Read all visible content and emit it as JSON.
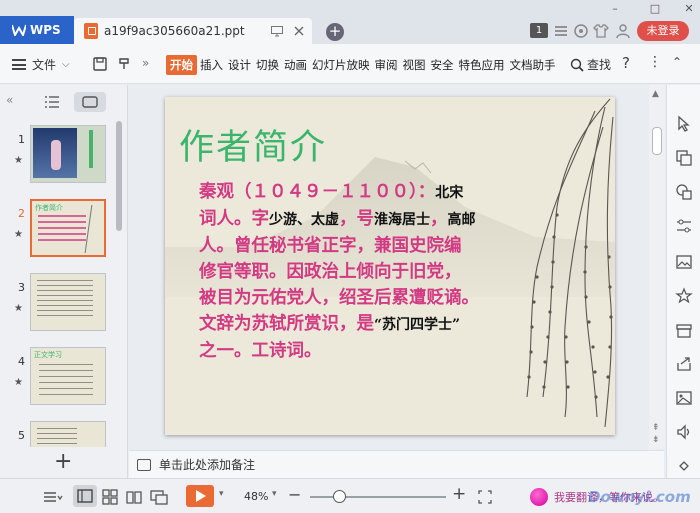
{
  "titlebar": {
    "app_tab": "WPS",
    "doc_tab": "a19f9ac305660a21.ppt",
    "page_badge": "1",
    "login_button": "未登录"
  },
  "menubar": {
    "file_menu": "文件",
    "tabs": [
      "开始",
      "插入",
      "设计",
      "切换",
      "动画",
      "幻灯片放映",
      "审阅",
      "视图",
      "安全",
      "特色应用",
      "文档助手"
    ],
    "active_tab": "开始",
    "find": "查找"
  },
  "thumbnails": [
    {
      "num": "1",
      "title": ""
    },
    {
      "num": "2",
      "title": "作者简介"
    },
    {
      "num": "3",
      "title": ""
    },
    {
      "num": "4",
      "title": "正文学习"
    },
    {
      "num": "5",
      "title": ""
    }
  ],
  "slide": {
    "title": "作者简介",
    "line1_a": "秦观（１０４９－１１００）",
    "line1_b": "：",
    "line1_c": "北宋",
    "line2_a": "词人。字",
    "line2_b": "少游、太虚",
    "line2_c": "，号",
    "line2_d": "淮海居士",
    "line2_e": "，",
    "line2_f": "高邮",
    "line3": "人。曾任秘书省正字，兼国史院编",
    "line4": "修官等职。因政治上倾向于旧党，",
    "line5": "被目为元佑党人，绍圣后累遭贬谪。",
    "line6_a": "文辞为苏轼所赏识，是",
    "line6_b": "“苏门四学士”",
    "line7": "之一。工诗词。"
  },
  "notes": {
    "placeholder": "单击此处添加备注"
  },
  "statusbar": {
    "zoom": "48%",
    "tip": "我要翻译，等你来说。"
  },
  "watermark": "Downyi.com",
  "colors": {
    "accent": "#e96a33",
    "title_green": "#3bb56c",
    "body_pink": "#d23a83",
    "wps_blue": "#2a64c9",
    "login_red": "#e0504a"
  }
}
